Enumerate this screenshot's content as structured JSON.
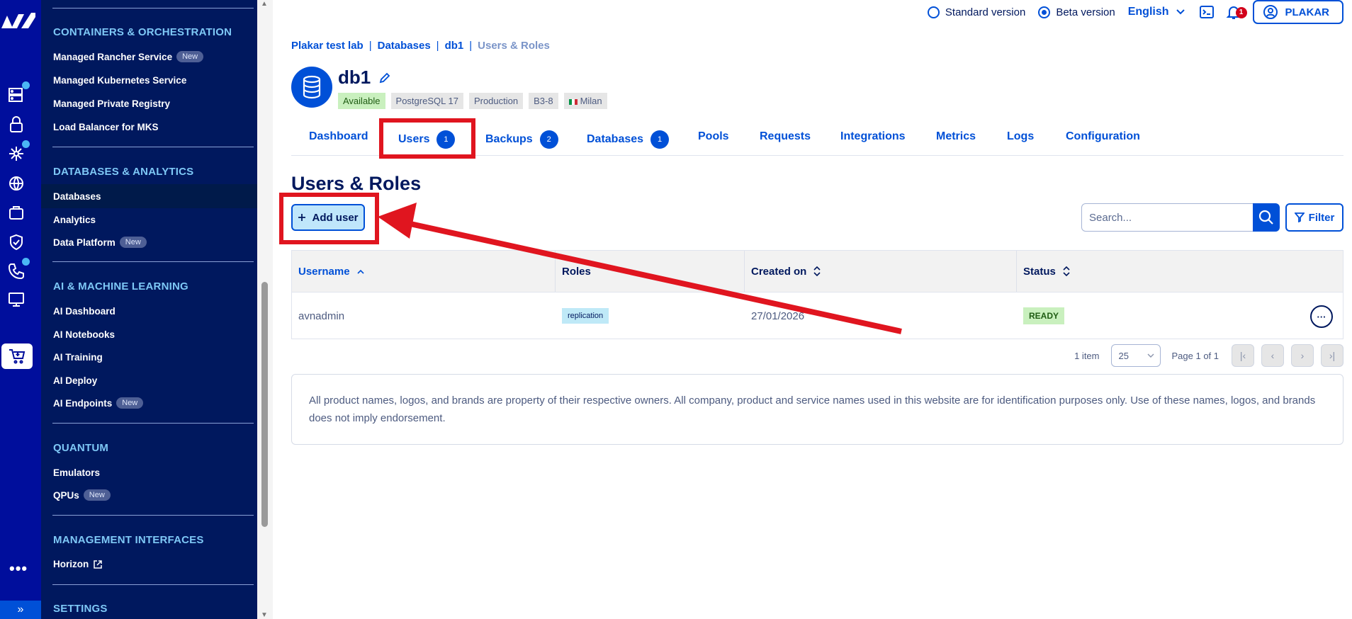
{
  "sidebar": {
    "sections": [
      {
        "title": "CONTAINERS & ORCHESTRATION",
        "items": [
          {
            "label": "Managed Rancher Service",
            "badge": "New"
          },
          {
            "label": "Managed Kubernetes Service"
          },
          {
            "label": "Managed Private Registry"
          },
          {
            "label": "Load Balancer for MKS"
          }
        ]
      },
      {
        "title": "DATABASES & ANALYTICS",
        "items": [
          {
            "label": "Databases",
            "active": true
          },
          {
            "label": "Analytics"
          },
          {
            "label": "Data Platform",
            "badge": "New"
          }
        ]
      },
      {
        "title": "AI & MACHINE LEARNING",
        "items": [
          {
            "label": "AI Dashboard"
          },
          {
            "label": "AI Notebooks"
          },
          {
            "label": "AI Training"
          },
          {
            "label": "AI Deploy"
          },
          {
            "label": "AI Endpoints",
            "badge": "New"
          }
        ]
      },
      {
        "title": "QUANTUM",
        "items": [
          {
            "label": "Emulators"
          },
          {
            "label": "QPUs",
            "badge": "New"
          }
        ]
      },
      {
        "title": "MANAGEMENT INTERFACES",
        "items": [
          {
            "label": "Horizon"
          }
        ]
      },
      {
        "title": "SETTINGS",
        "items": []
      }
    ],
    "more_label": "•••",
    "expand_label": "»"
  },
  "topbar": {
    "standard_version": "Standard version",
    "beta_version": "Beta version",
    "language": "English",
    "notification_count": "1",
    "user": "PLAKAR"
  },
  "breadcrumb": [
    "Plakar test lab",
    "Databases",
    "db1",
    "Users & Roles"
  ],
  "service": {
    "name": "db1",
    "chips": [
      "Available",
      "PostgreSQL 17",
      "Production",
      "B3-8",
      "Milan"
    ]
  },
  "tabs": [
    {
      "label": "Dashboard"
    },
    {
      "label": "Users",
      "count": "1",
      "active": true
    },
    {
      "label": "Backups",
      "count": "2"
    },
    {
      "label": "Databases",
      "count": "1"
    },
    {
      "label": "Pools"
    },
    {
      "label": "Requests"
    },
    {
      "label": "Integrations"
    },
    {
      "label": "Metrics"
    },
    {
      "label": "Logs"
    },
    {
      "label": "Configuration"
    }
  ],
  "page": {
    "title": "Users & Roles",
    "add_user": "Add user",
    "search_placeholder": "Search...",
    "filter": "Filter"
  },
  "table": {
    "columns": [
      "Username",
      "Roles",
      "Created on",
      "Status"
    ],
    "rows": [
      {
        "username": "avnadmin",
        "role": "replication",
        "created": "27/01/2026",
        "status": "READY"
      }
    ]
  },
  "pagination": {
    "items": "1 item",
    "page_size": "25",
    "page_label": "Page 1 of 1"
  },
  "notice": "All product names, logos, and brands are property of their respective owners. All company, product and service names used in this website are for identification purposes only. Use of these names, logos, and brands does not imply endorsement.",
  "colors": {
    "brand": "#000e9c",
    "sidebar": "#00185e",
    "accent": "#0050d7",
    "annotation": "#e0151f"
  }
}
